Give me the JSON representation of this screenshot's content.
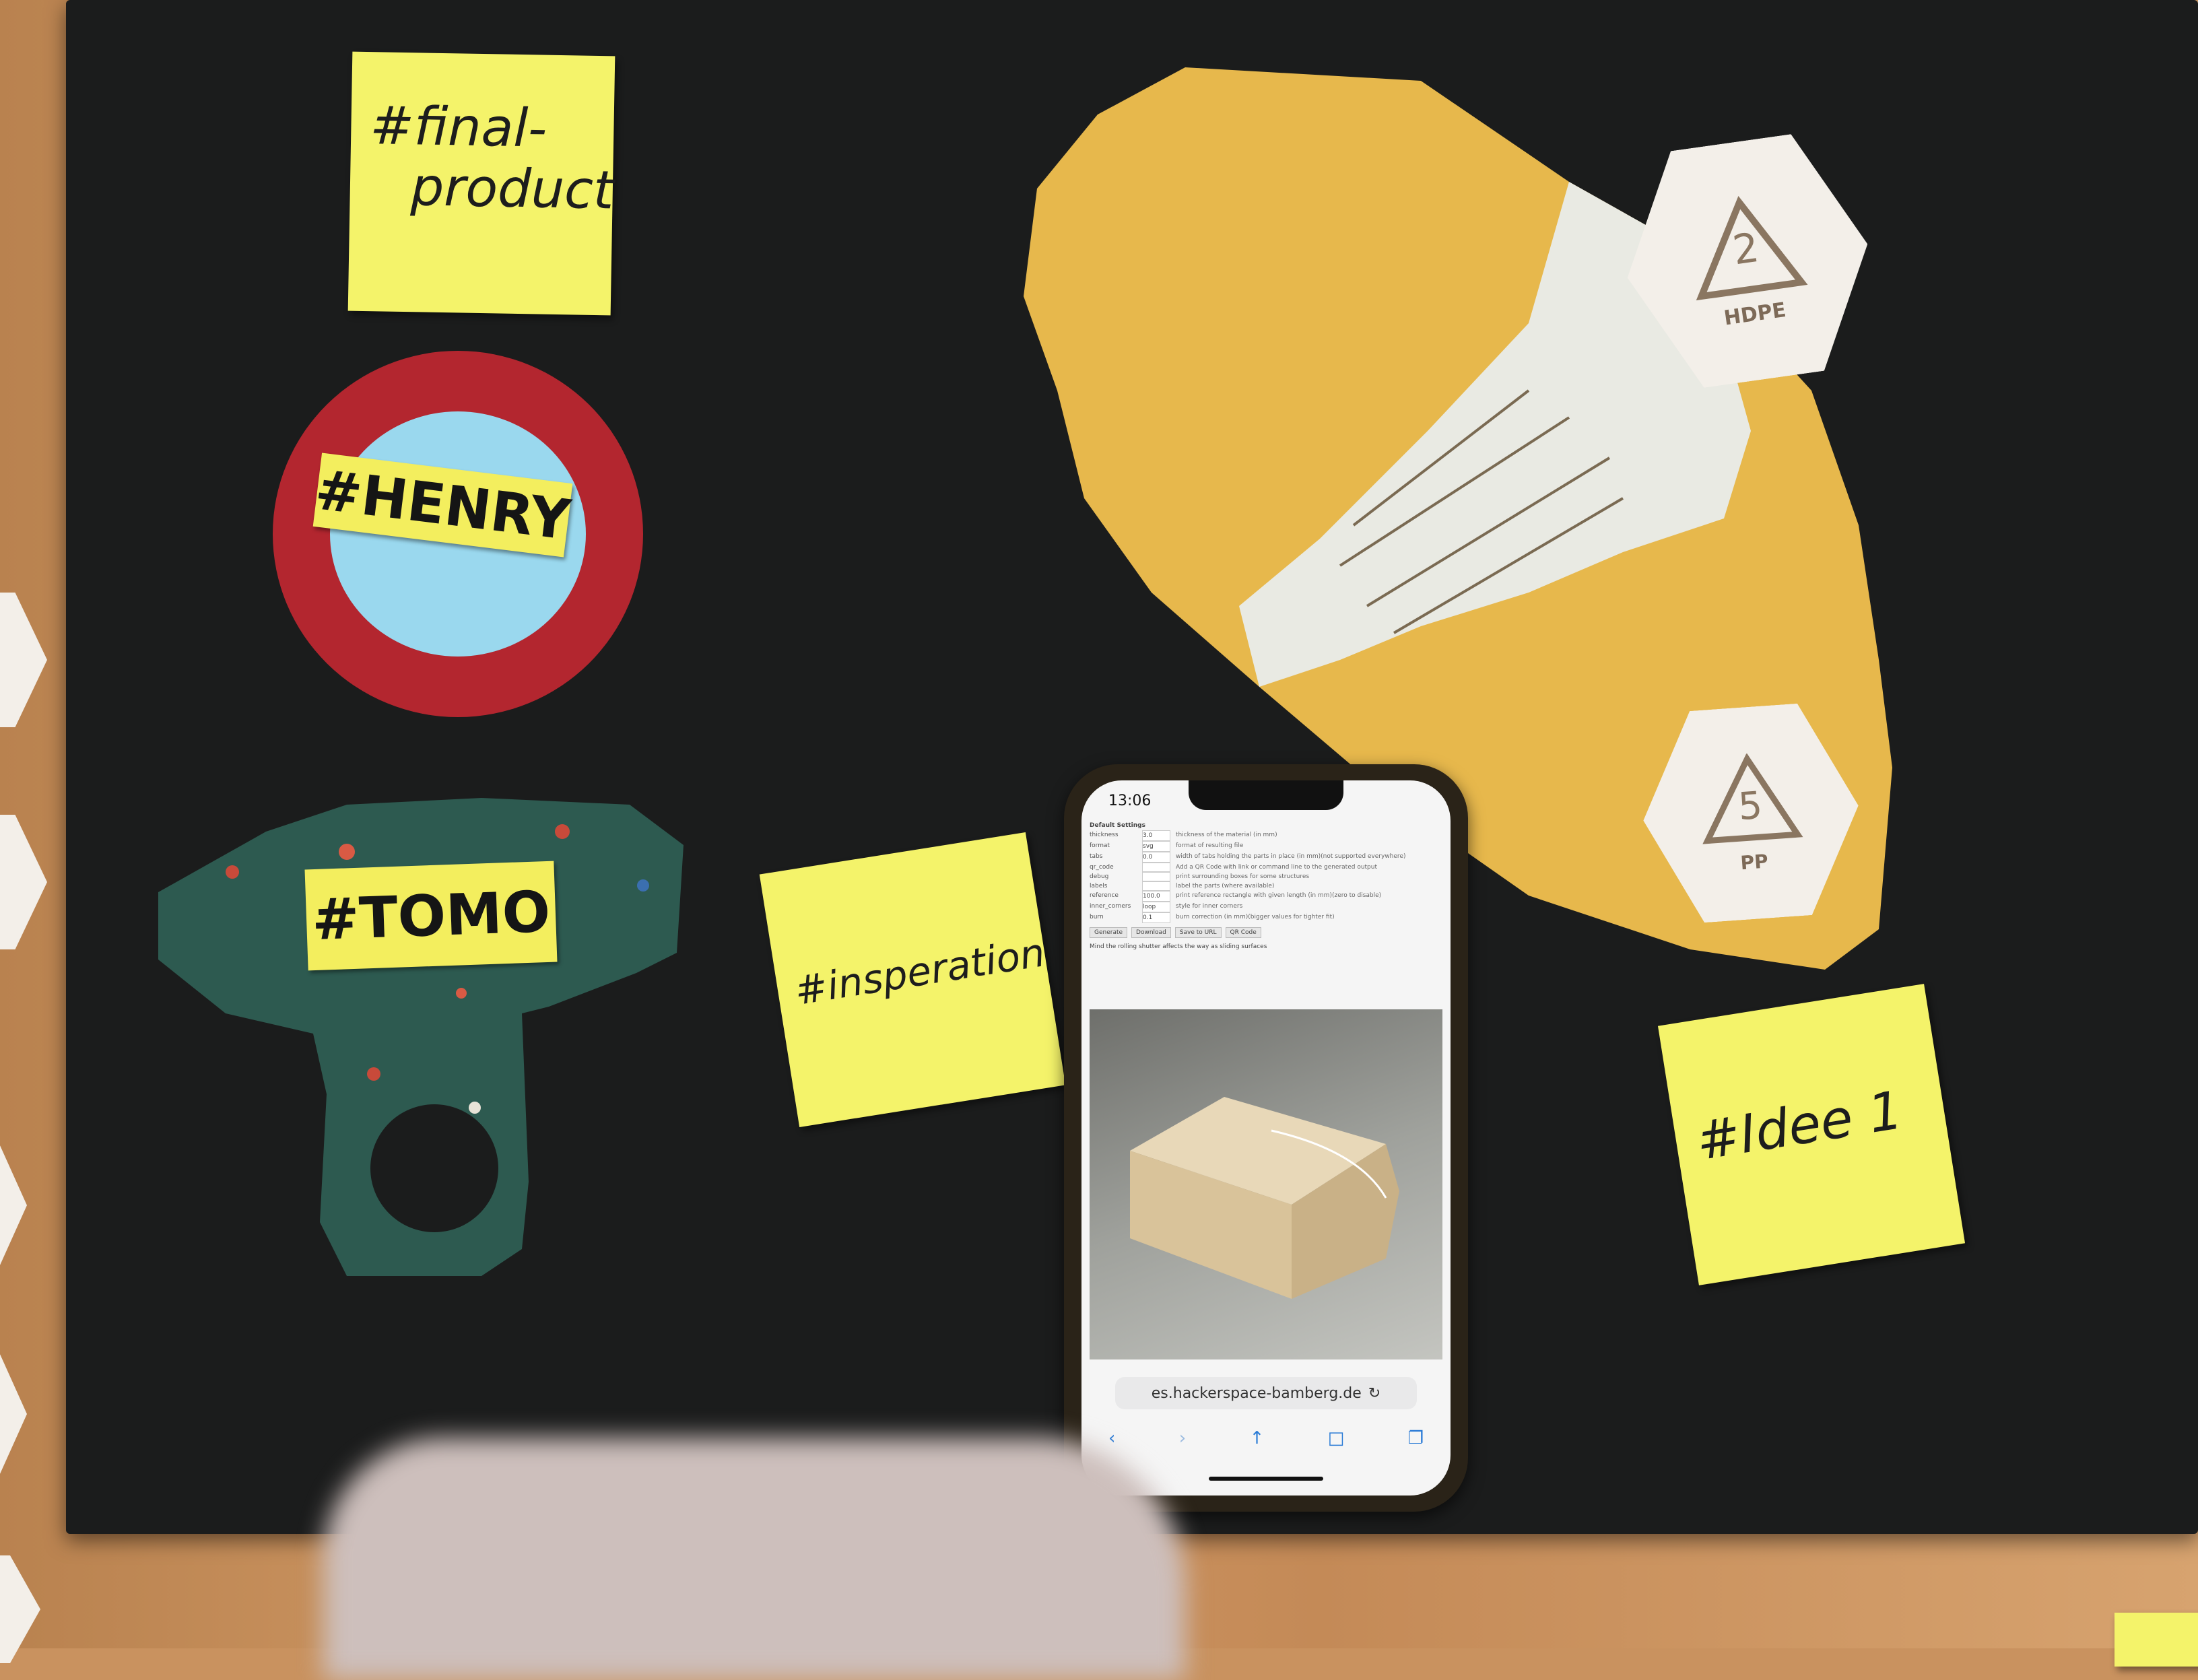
{
  "notes": {
    "final_product": {
      "line1": "#final-",
      "line2": "product"
    },
    "inspiration": "#insperation",
    "idee": "#Idee 1"
  },
  "labels": {
    "henry": "#HENRY",
    "tomo": "#TOMO"
  },
  "recycling_tiles": {
    "hdpe": {
      "number": "2",
      "code": "HDPE"
    },
    "pp": {
      "number": "5",
      "code": "PP"
    }
  },
  "phone": {
    "time": "13:06",
    "url": "es.hackerspace-bamberg.de",
    "settings_title": "Default Settings",
    "settings_rows": [
      {
        "key": "thickness",
        "value": "3.0",
        "desc": "thickness of the material (in mm)"
      },
      {
        "key": "format",
        "value": "svg",
        "desc": "format of resulting file"
      },
      {
        "key": "tabs",
        "value": "0.0",
        "desc": "width of tabs holding the parts in place (in mm)(not supported everywhere)"
      },
      {
        "key": "qr_code",
        "value": "",
        "desc": "Add a QR Code with link or command line to the generated output"
      },
      {
        "key": "debug",
        "value": "",
        "desc": "print surrounding boxes for some structures"
      },
      {
        "key": "labels",
        "value": "",
        "desc": "label the parts (where available)"
      },
      {
        "key": "reference",
        "value": "100.0",
        "desc": "print reference rectangle with given length (in mm)(zero to disable)"
      },
      {
        "key": "inner_corners",
        "value": "loop",
        "desc": "style for inner corners"
      },
      {
        "key": "burn",
        "value": "0.1",
        "desc": "burn correction (in mm)(bigger values for tighter fit)"
      }
    ],
    "buttons": [
      "Generate",
      "Download",
      "Save to URL",
      "QR Code"
    ],
    "footer_note": "Mind the rolling shutter affects the way as sliding surfaces"
  },
  "colors": {
    "board": "#1b1c1c",
    "sticky": "#f4f36a",
    "label": "#f3ee5e",
    "red_ring": "#b3262f",
    "blue_disc": "#9ad8ee",
    "yellow_sheet": "#e7b84c",
    "green_sheet": "#2d5a50"
  }
}
